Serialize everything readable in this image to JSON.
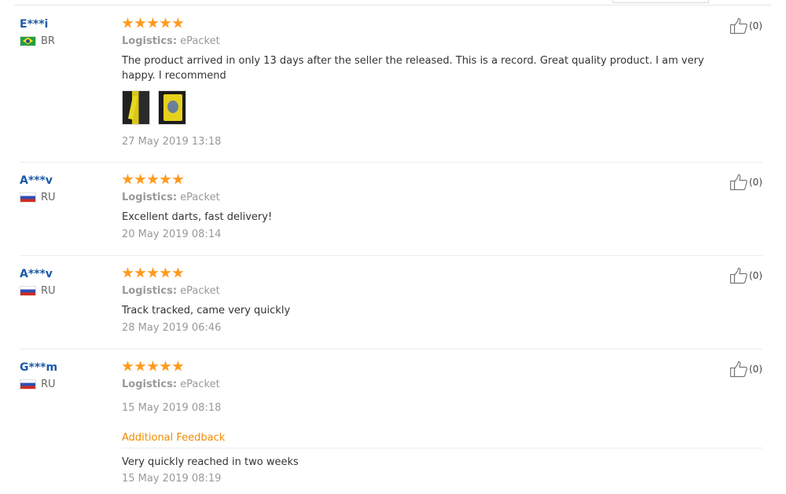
{
  "logistics_label": "Logistics:",
  "reviews": [
    {
      "user": "E***i",
      "country": "BR",
      "rating": 5,
      "logistics": "ePacket",
      "text": "The product arrived in only 13 days after the seller the released. This is a record. Great quality product. I am very happy. I recommend",
      "photos": [
        "review-photo-1",
        "review-photo-2"
      ],
      "date": "27 May 2019 13:18",
      "useful": "(0)"
    },
    {
      "user": "A***v",
      "country": "RU",
      "rating": 5,
      "logistics": "ePacket",
      "text": "Excellent darts, fast delivery!",
      "date": "20 May 2019 08:14",
      "useful": "(0)"
    },
    {
      "user": "A***v",
      "country": "RU",
      "rating": 5,
      "logistics": "ePacket",
      "text": "Track tracked, came very quickly",
      "date": "28 May 2019 06:46",
      "useful": "(0)"
    },
    {
      "user": "G***m",
      "country": "RU",
      "rating": 5,
      "logistics": "ePacket",
      "text": "",
      "date": "15 May 2019 08:18",
      "useful": "(0)",
      "additional_feedback": {
        "title": "Additional Feedback",
        "text": "Very quickly reached in two weeks",
        "date": "15 May 2019 08:19"
      }
    }
  ],
  "colors": {
    "username": "#1d5aa6",
    "star": "#ff9a1e",
    "additional_feedback": "#f28c00",
    "muted_text": "#999999"
  },
  "icons": {
    "useful": "thumbs-up-icon",
    "rating": "star-icon"
  }
}
